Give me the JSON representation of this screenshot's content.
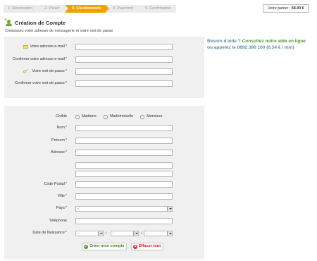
{
  "steps": [
    {
      "label": "1- Réservation",
      "active": false
    },
    {
      "label": "2- Panier",
      "active": false
    },
    {
      "label": "3- Coordonnées",
      "active": true
    },
    {
      "label": "4- Paiement",
      "active": false
    },
    {
      "label": "5- Confirmation",
      "active": false
    }
  ],
  "cart": {
    "label": "Votre panier :",
    "amount": "58.00 €"
  },
  "header": {
    "title": "Création de Compte",
    "subtitle": "Choisissez votre adresse de messagerie et votre mot de passe"
  },
  "account": {
    "email_label": "Votre adresse e-mail",
    "email_confirm_label": "Confirmer votre adresse e-mail",
    "password_label": "Votre mot de passe",
    "password_confirm_label": "Confirmer votre mot de passe",
    "required_mark": "*"
  },
  "profile": {
    "civility_label": "Civilité",
    "civility_options": [
      "Madame",
      "Mademoiselle",
      "Monsieur"
    ],
    "name_label": "Nom",
    "firstname_label": "Prénom",
    "address_label": "Adresse",
    "postal_label": "Code Postal",
    "city_label": "Ville",
    "country_label": "Pays",
    "country_value": "-",
    "phone_label": "Téléphone",
    "birthdate_label": "Date de Naissance",
    "day_value": "-",
    "month_value": "-",
    "year_value": "-",
    "date_separator": "/",
    "required_mark": "*"
  },
  "buttons": {
    "create": "Créer mon compte",
    "clear": "Effacer tout"
  },
  "help": {
    "question": "Besoin d'aide ?",
    "link": "Consultez notre aide en ligne",
    "phone_line": "ou appelez le 0892 390 100 (0.34 € / min)"
  },
  "colors": {
    "active_step": "#f2a100",
    "panel_bg": "#f0f0f0",
    "help_link": "#4a9a2a",
    "help_text": "#5a8fa0",
    "required": "#cc0000"
  },
  "icons": {
    "title": "user-add-icon",
    "email": "email-icon",
    "password": "key-icon",
    "create": "check-icon",
    "clear": "close-icon"
  }
}
